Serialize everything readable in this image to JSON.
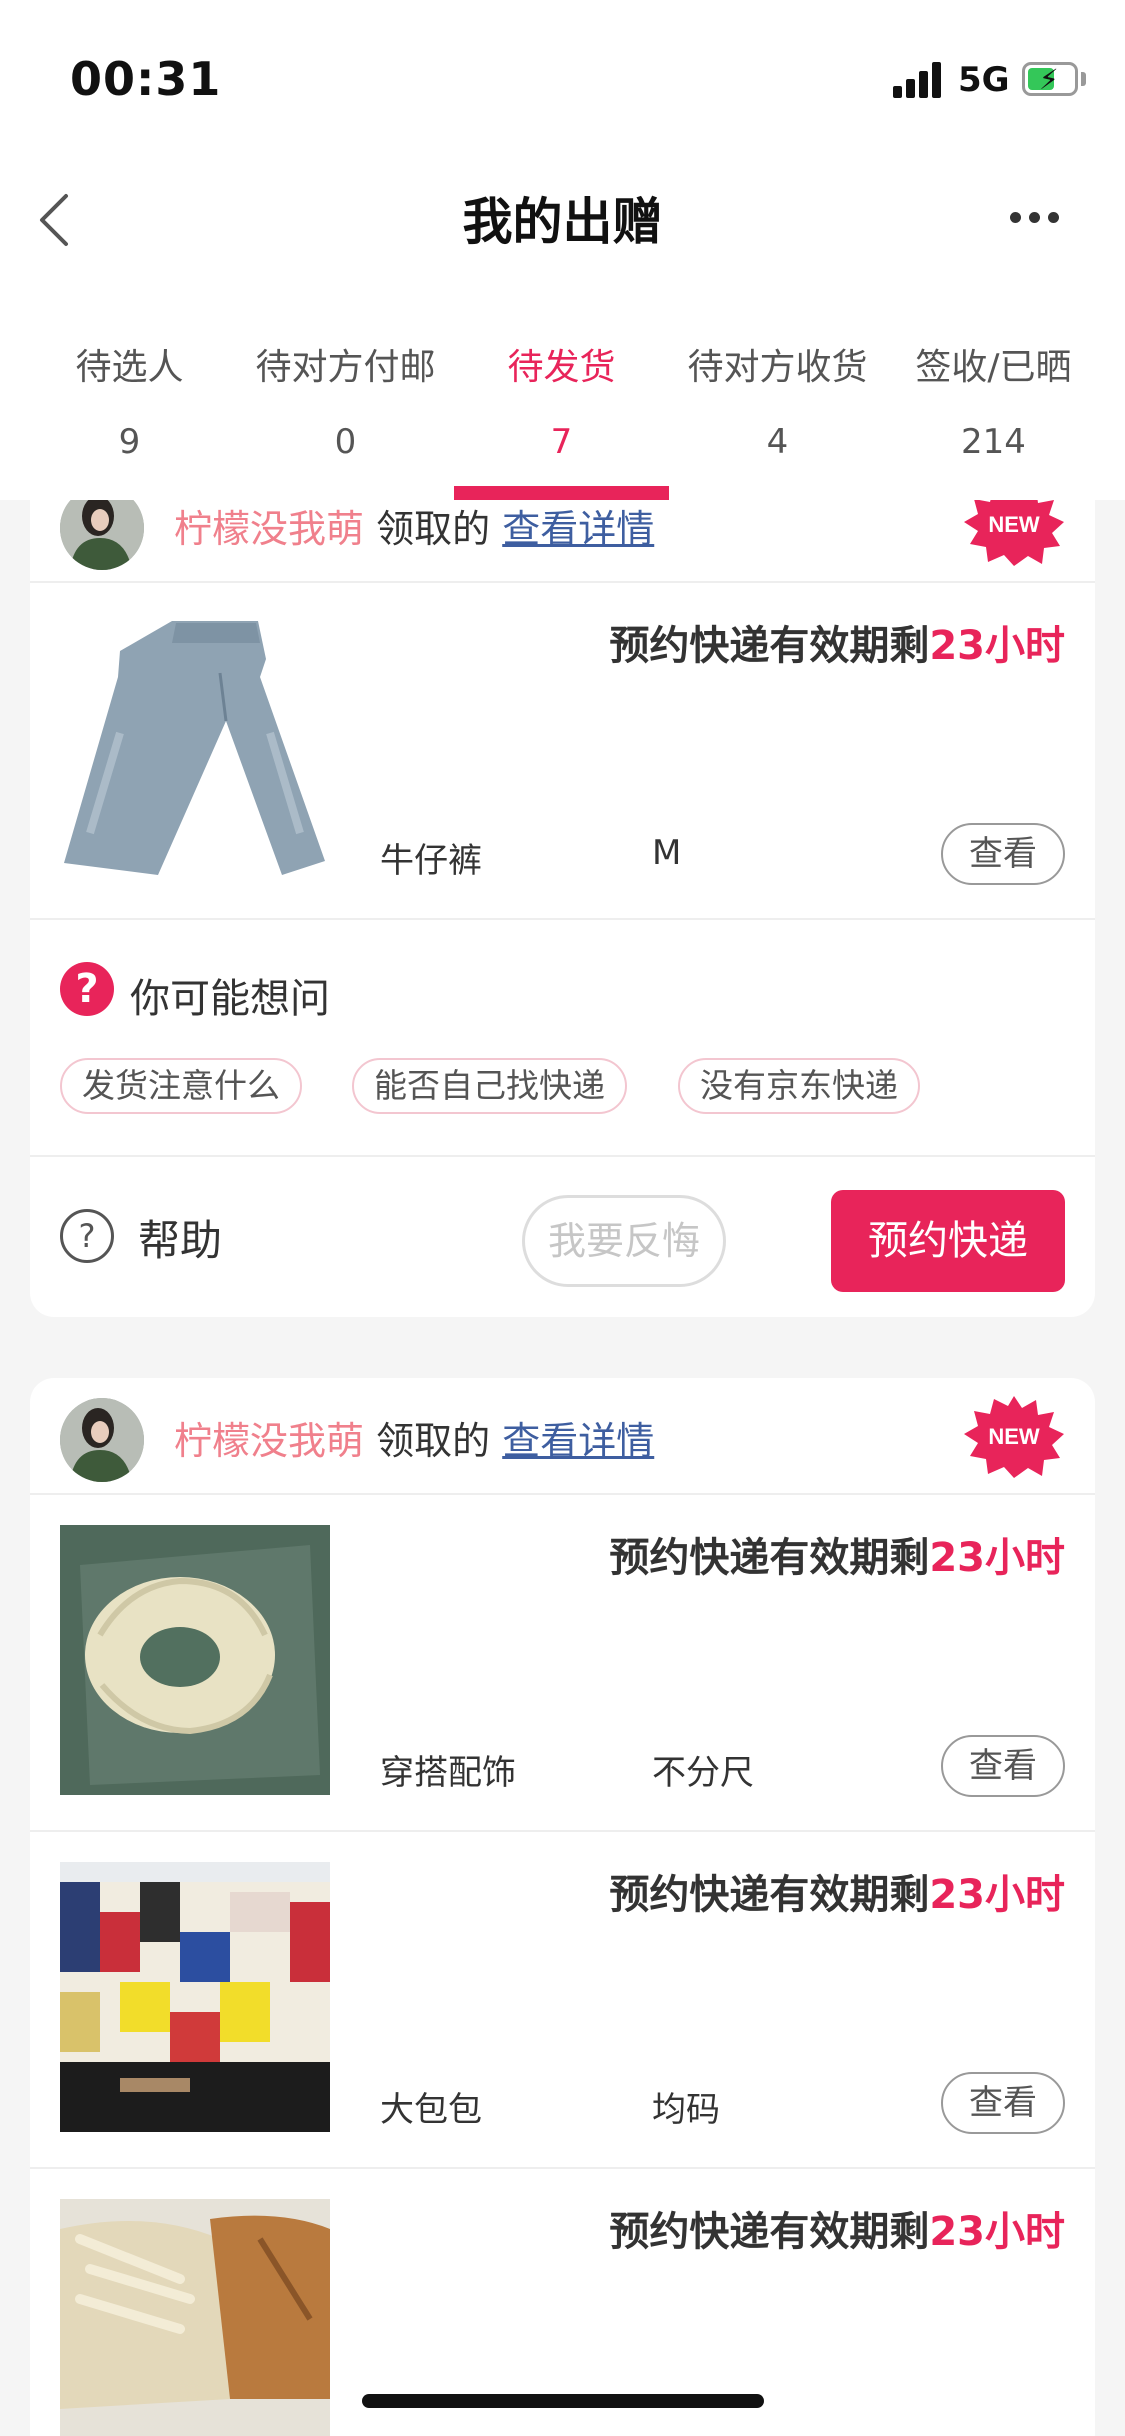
{
  "status_bar": {
    "time": "00:31",
    "network": "5G"
  },
  "nav": {
    "title": "我的出赠"
  },
  "tabs": [
    {
      "label": "待选人",
      "count": "9"
    },
    {
      "label": "待对方付邮",
      "count": "0"
    },
    {
      "label": "待发货",
      "count": "7",
      "active": true
    },
    {
      "label": "待对方收货",
      "count": "4"
    },
    {
      "label": "签收/已晒",
      "count": "214"
    }
  ],
  "orders": [
    {
      "user": "柠檬没我萌",
      "claimed_text": "领取的",
      "detail_link": "查看详情",
      "badge": "NEW",
      "items": [
        {
          "deadline_prefix": "预约快递有效期剩",
          "deadline_value": "23小时",
          "name": "牛仔裤",
          "size": "M",
          "view_label": "查看"
        }
      ],
      "faq": {
        "title": "你可能想问",
        "chips": [
          "发货注意什么",
          "能否自己找快递",
          "没有京东快递"
        ]
      },
      "actions": {
        "help": "帮助",
        "regret": "我要反悔",
        "ship": "预约快递"
      }
    },
    {
      "user": "柠檬没我萌",
      "claimed_text": "领取的",
      "detail_link": "查看详情",
      "badge": "NEW",
      "items": [
        {
          "deadline_prefix": "预约快递有效期剩",
          "deadline_value": "23小时",
          "name": "穿搭配饰",
          "size": "不分尺",
          "view_label": "查看"
        },
        {
          "deadline_prefix": "预约快递有效期剩",
          "deadline_value": "23小时",
          "name": "大包包",
          "size": "均码",
          "view_label": "查看"
        },
        {
          "deadline_prefix": "预约快递有效期剩",
          "deadline_value": "23小时",
          "name": "",
          "size": "",
          "view_label": ""
        }
      ]
    }
  ],
  "colors": {
    "accent": "#e8245a",
    "user_name": "#f0808c",
    "link": "#3e5ea0"
  }
}
